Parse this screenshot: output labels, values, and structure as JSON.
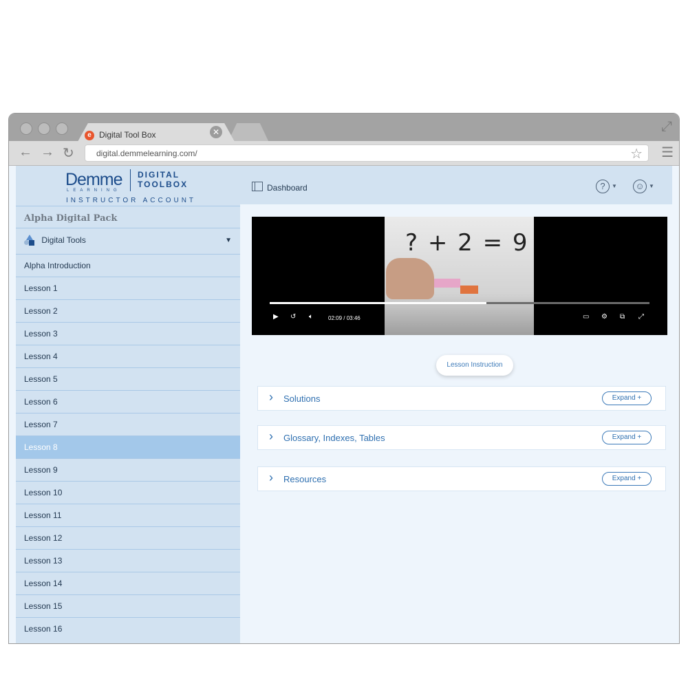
{
  "browser": {
    "tab_title": "Digital Tool Box",
    "favicon_letter": "e",
    "url": "digital.demmelearning.com/"
  },
  "brand": {
    "demme": "Demme",
    "learning": "LEARNING",
    "digital": "DIGITAL",
    "toolbox": "TOOLBOX",
    "account": "INSTRUCTOR ACCOUNT"
  },
  "sidebar": {
    "pack_title": "Alpha Digital Pack",
    "tools_label": "Digital Tools",
    "items": [
      "Alpha Introduction",
      "Lesson 1",
      "Lesson 2",
      "Lesson 3",
      "Lesson 4",
      "Lesson 5",
      "Lesson 6",
      "Lesson 7",
      "Lesson 8",
      "Lesson 9",
      "Lesson 10",
      "Lesson 11",
      "Lesson 12",
      "Lesson 13",
      "Lesson 14",
      "Lesson 15",
      "Lesson 16"
    ],
    "active_item": "Lesson 8"
  },
  "topbar": {
    "dashboard_label": "Dashboard"
  },
  "video": {
    "equation": "? + 2 = 9",
    "current_time": "02:09",
    "duration": "03:46",
    "progress": 0.57
  },
  "lesson_instruction_label": "Lesson Instruction",
  "sections": [
    {
      "label": "Solutions",
      "button": "Expand +"
    },
    {
      "label": "Glossary, Indexes, Tables",
      "button": "Expand +"
    },
    {
      "label": "Resources",
      "button": "Expand +"
    }
  ],
  "colors": {
    "brand_blue": "#1d4d8b",
    "sidebar_bg": "#d2e2f1",
    "active_item_bg": "#a3c8ea",
    "link_blue": "#2e6fb0"
  }
}
